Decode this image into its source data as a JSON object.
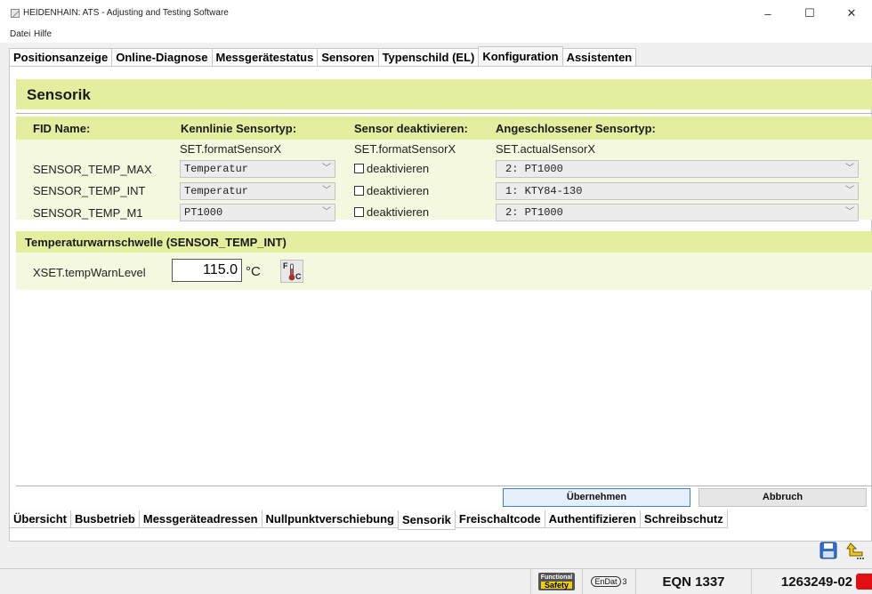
{
  "window": {
    "title": "HEIDENHAIN: ATS - Adjusting and Testing Software",
    "minimize": "–",
    "maximize": "☐",
    "close": "✕"
  },
  "menu": [
    "Datei",
    "Hilfe"
  ],
  "top_tabs": [
    {
      "label": "Positionsanzeige",
      "active": false
    },
    {
      "label": "Online-Diagnose",
      "active": false
    },
    {
      "label": "Messgerätestatus",
      "active": false
    },
    {
      "label": "Sensoren",
      "active": false
    },
    {
      "label": "Typenschild (EL)",
      "active": false
    },
    {
      "label": "Konfiguration",
      "active": true
    },
    {
      "label": "Assistenten",
      "active": false
    }
  ],
  "section": {
    "title": "Sensorik",
    "columns": {
      "fid": "FID Name:",
      "kennlinie": "Kennlinie Sensortyp:",
      "deaktivieren": "Sensor deaktivieren:",
      "angeschlossen": "Angeschlossener Sensortyp:"
    },
    "subheaders": {
      "kennlinie": "SET.formatSensorX",
      "deaktivieren": "SET.formatSensorX",
      "angeschlossen": "SET.actualSensorX"
    },
    "rows": [
      {
        "name": "SENSOR_TEMP_MAX",
        "kennlinie": "Temperatur",
        "checkbox": "deaktivieren",
        "checked": false,
        "sensortyp": "2: PT1000"
      },
      {
        "name": "SENSOR_TEMP_INT",
        "kennlinie": "Temperatur",
        "checkbox": "deaktivieren",
        "checked": false,
        "sensortyp": "1: KTY84-130"
      },
      {
        "name": "SENSOR_TEMP_M1",
        "kennlinie": "PT1000",
        "checkbox": "deaktivieren",
        "checked": false,
        "sensortyp": "2: PT1000"
      }
    ]
  },
  "temp": {
    "title": "Temperaturwarnschwelle (SENSOR_TEMP_INT)",
    "label": "XSET.tempWarnLevel",
    "value": "115.0",
    "unit": "°C",
    "toggle_top": "F",
    "toggle_bottom": "C"
  },
  "buttons": {
    "apply": "Übernehmen",
    "cancel": "Abbruch"
  },
  "bottom_tabs": [
    {
      "label": "Übersicht",
      "active": false
    },
    {
      "label": "Busbetrieb",
      "active": false
    },
    {
      "label": "Messgeräteadressen",
      "active": false
    },
    {
      "label": "Nullpunktverschiebung",
      "active": false
    },
    {
      "label": "Sensorik",
      "active": true
    },
    {
      "label": "Freischaltcode",
      "active": false
    },
    {
      "label": "Authentifizieren",
      "active": false
    },
    {
      "label": "Schreibschutz",
      "active": false
    }
  ],
  "status": {
    "fs_top": "Functional",
    "fs_bottom": "Safety",
    "endat": "EnDat",
    "endat_ver": "3",
    "device": "EQN 1337",
    "id": "1263249-02"
  },
  "colors": {
    "header_band": "#e3ef9e",
    "body_band": "#f4f8de",
    "apply_border": "#3c7fd6",
    "status_red": "#e01010"
  }
}
